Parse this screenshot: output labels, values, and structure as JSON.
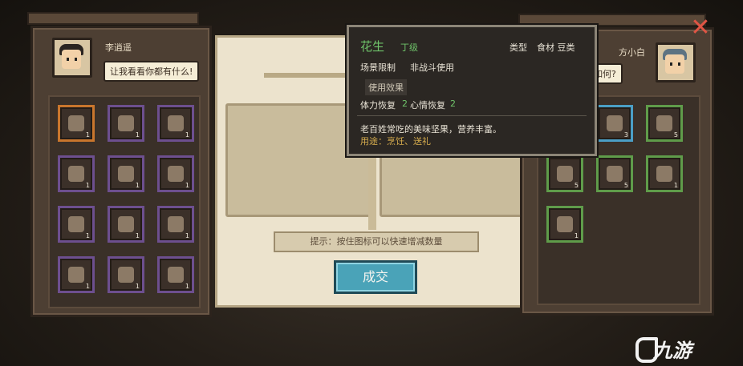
{
  "left_player": {
    "name": "李逍遥",
    "speech": "让我看看你都有什么!"
  },
  "right_player": {
    "name": "方小白",
    "speech": "看看我东西如何?"
  },
  "left_items": [
    {
      "icon": "chest-icon",
      "qty": "1",
      "rarity": "orange"
    },
    {
      "icon": "blade-icon",
      "qty": "1",
      "rarity": "purple"
    },
    {
      "icon": "jade-icon",
      "qty": "1",
      "rarity": "purple"
    },
    {
      "icon": "herb-icon",
      "qty": "1",
      "rarity": "purple"
    },
    {
      "icon": "scroll-icon",
      "qty": "1",
      "rarity": "purple"
    },
    {
      "icon": "leaf-icon",
      "qty": "1",
      "rarity": "purple"
    },
    {
      "icon": "jar-icon",
      "qty": "1",
      "rarity": "purple"
    },
    {
      "icon": "bar-icon",
      "qty": "1",
      "rarity": "purple"
    },
    {
      "icon": "key-icon",
      "qty": "1",
      "rarity": "purple"
    },
    {
      "icon": "book-icon",
      "qty": "1",
      "rarity": "purple"
    },
    {
      "icon": "map-icon",
      "qty": "1",
      "rarity": "purple"
    },
    {
      "icon": "map-icon",
      "qty": "1",
      "rarity": "purple"
    }
  ],
  "right_items": [
    {
      "icon": "pouch-icon",
      "qty": "3",
      "rarity": "blue"
    },
    {
      "icon": "dumpling-icon",
      "qty": "3",
      "rarity": "blue"
    },
    {
      "icon": "salt-icon",
      "qty": "5",
      "rarity": "green"
    },
    {
      "icon": "stone-icon",
      "qty": "5",
      "rarity": "green"
    },
    {
      "icon": "peanut-icon",
      "qty": "5",
      "rarity": "green"
    },
    {
      "icon": "egg-icon",
      "qty": "1",
      "rarity": "green"
    },
    {
      "icon": "sack-icon",
      "qty": "1",
      "rarity": "green"
    }
  ],
  "center": {
    "hint": "提示：按住图标可以快速增减数量",
    "deal_label": "成交"
  },
  "tooltip": {
    "name": "花生",
    "grade": "丁级",
    "type_label": "类型",
    "type_value": "食材 豆类",
    "scene_limit": "场景限制",
    "scene_value": "非战斗使用",
    "effect_header": "使用效果",
    "stamina_label": "体力恢复",
    "stamina_value": "2",
    "mood_label": "心情恢复",
    "mood_value": "2",
    "description": "老百姓常吃的美味坚果，营养丰富。",
    "usage": "用途：烹饪、送礼"
  },
  "watermark": "九游",
  "colors": {
    "purple": "#6d4f8f",
    "orange": "#c9762d",
    "green": "#5f9c4a",
    "blue": "#4b9fc6",
    "deal": "#4aa3b8"
  }
}
